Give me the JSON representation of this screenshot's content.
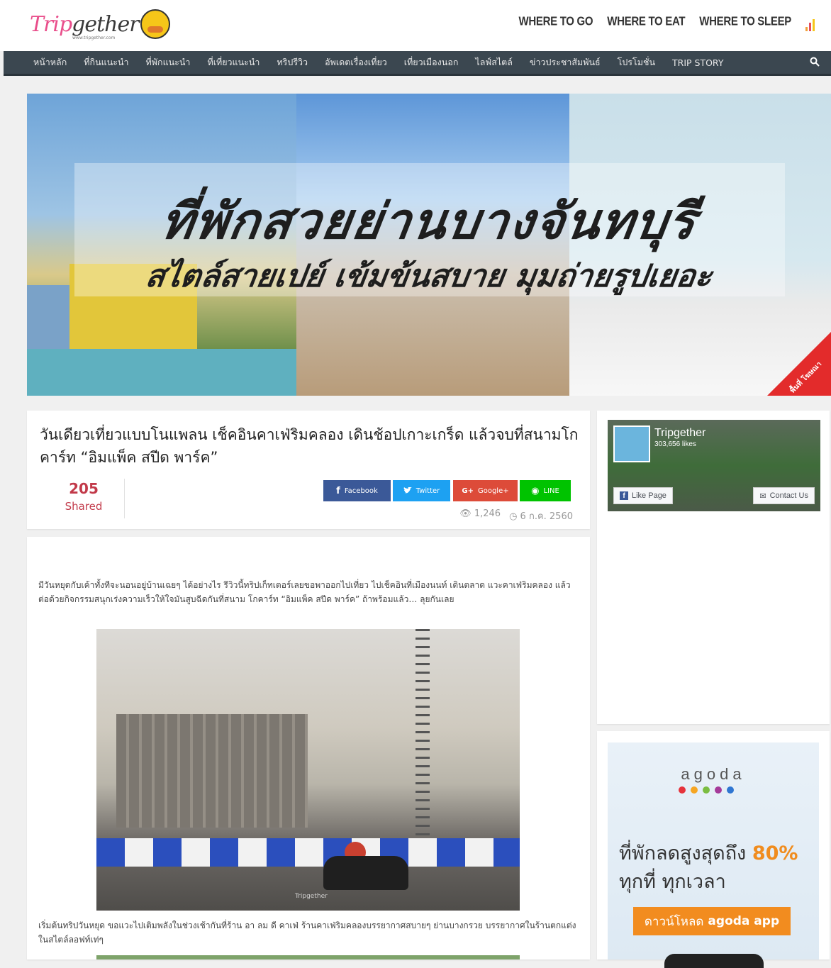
{
  "header": {
    "logo_text_a": "Trip",
    "logo_text_b": "gether",
    "logo_sub": "www.tripgether.com",
    "links": [
      "WHERE TO GO",
      "WHERE TO EAT",
      "WHERE TO SLEEP"
    ]
  },
  "nav": {
    "items": [
      "หน้าหลัก",
      "ที่กินแนะนำ",
      "ที่พักแนะนำ",
      "ที่เที่ยวแนะนำ",
      "ทริปรีวิว",
      "อัพเดตเรื่องเที่ยว",
      "เที่ยวเมืองนอก",
      "ไลฟ์สไตล์",
      "ข่าวประชาสัมพันธ์",
      "โปรโมชั่น",
      "TRIP STORY"
    ]
  },
  "hero": {
    "line1": "ที่พักสวยย่านบางจันทบุรี",
    "line2": "สไตล์สายเปย์ เข้มข้นสบาย มุมถ่ายรูปเยอะ",
    "corner_badge": "พื้นที่ โฆษณา"
  },
  "article": {
    "title": "วันเดียวเที่ยวแบบโนแพลน เช็คอินคาเฟ่ริมคลอง เดินช้อปเกาะเกร็ด แล้วจบที่สนามโกคาร์ท “อิมแพ็ค สปีด พาร์ค”",
    "share_count": "205",
    "share_label": "Shared",
    "share_buttons": [
      {
        "icon": "f",
        "label": "Facebook",
        "color": "#3b5998"
      },
      {
        "icon": "t",
        "label": "Twitter",
        "color": "#1da1f2"
      },
      {
        "icon": "G+",
        "label": "Google+",
        "color": "#dd4b39"
      },
      {
        "icon": "◉",
        "label": "LINE",
        "color": "#00c300"
      }
    ],
    "views": "1,246",
    "date": "6 ก.ค. 2560",
    "paragraph1": "มีวันหยุดกับเค้าทั้งทีจะนอนอยู่บ้านเฉยๆ ได้อย่างไร รีวิวนี้ทริปเก็ทเตอร์เลยขอพาออกไปเที่ยว ไปเช็คอินที่เมืองนนท์ เดินตลาด แวะคาเฟ่ริมคลอง แล้วต่อด้วยกิจกรรมสนุกเร่งความเร็วให้ใจมันสูบฉีดกันที่สนาม โกคาร์ท “อิมแพ็ค สปีด พาร์ค” ถ้าพร้อมแล้ว… ลุยกันเลย",
    "photo_watermark": "Tripgether",
    "paragraph2": "เริ่มต้นทริปวันหยุด ขอแวะไปเติมพลังในช่วงเช้ากันที่ร้าน อา ลม ดี คาเฟ่ ร้านคาเฟ่ริมคลองบรรยากาศสบายๆ ย่านบางกรวย บรรยากาศในร้านตกแต่งในสไตล์ลอฟท์เท่ๆ"
  },
  "facebook": {
    "name": "Tripgether",
    "likes": "303,656 likes",
    "like_button": "Like Page",
    "contact_button": "Contact Us"
  },
  "ad": {
    "brand": "agoda",
    "line1_prefix": "ที่พักลดสูงสุดถึง",
    "line1_highlight": "80%",
    "line2": "ทุกที่ ทุกเวลา",
    "button_prefix": "ดาวน์โหลด",
    "button_bold": "agoda app"
  },
  "colors": {
    "nav_bg": "#3b4750",
    "accent_pink": "#e94e8b",
    "share_red": "#c23a4a",
    "agoda_orange": "#f28c1f"
  }
}
